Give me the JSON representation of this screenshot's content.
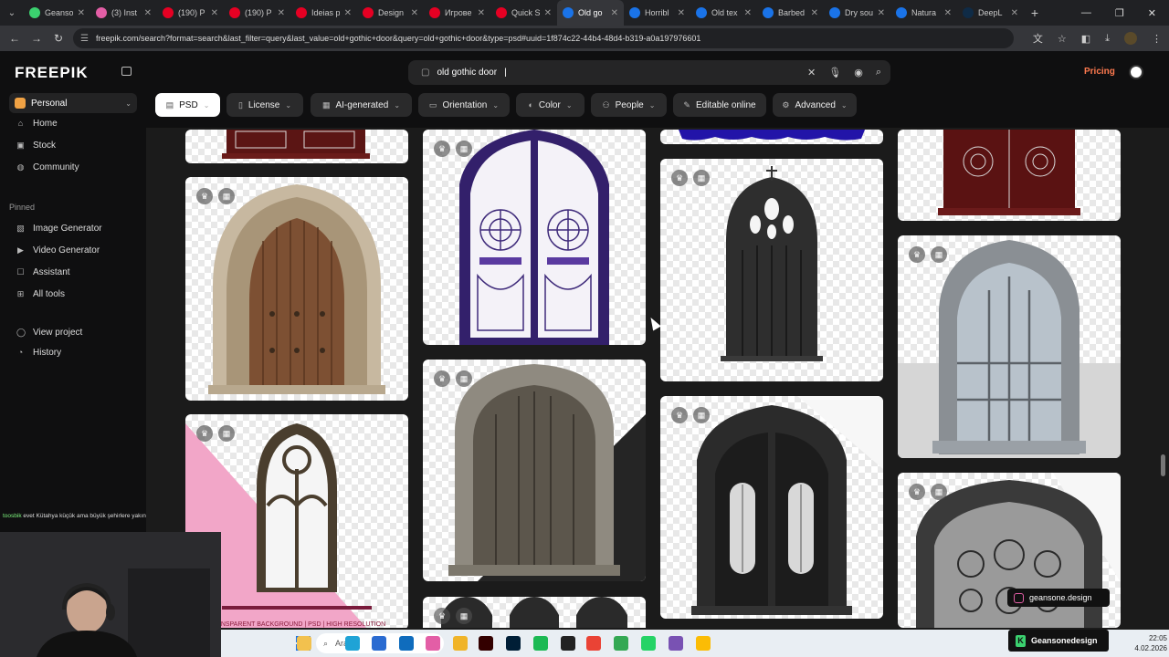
{
  "browser": {
    "tabs": [
      {
        "title": "Geanso",
        "color": "#3bd16f"
      },
      {
        "title": "(3) Inst",
        "color": "#e35ea6"
      },
      {
        "title": "(190) P",
        "color": "#e60023"
      },
      {
        "title": "(190) P",
        "color": "#e60023"
      },
      {
        "title": "Ideias p",
        "color": "#e60023"
      },
      {
        "title": "Design",
        "color": "#e60023"
      },
      {
        "title": "Игрове",
        "color": "#e60023"
      },
      {
        "title": "Quick S",
        "color": "#e60023"
      },
      {
        "title": "Old go",
        "color": "#1a73e8",
        "active": true
      },
      {
        "title": "Horribl",
        "color": "#1a73e8"
      },
      {
        "title": "Old tex",
        "color": "#1a73e8"
      },
      {
        "title": "Barbed",
        "color": "#1a73e8"
      },
      {
        "title": "Dry sou",
        "color": "#1a73e8"
      },
      {
        "title": "Natura",
        "color": "#1a73e8"
      },
      {
        "title": "DeepL",
        "color": "#0f2b46"
      }
    ],
    "url": "freepik.com/search?format=search&last_filter=query&last_value=old+gothic+door&query=old+gothic+door&type=psd#uuid=1f874c22-44b4-48d4-b319-a0a197976601"
  },
  "freepik": {
    "logo": "FREEPIK",
    "search_value": "old gothic door",
    "pricing": "Pricing",
    "workspace": "Personal",
    "nav_main": [
      {
        "label": "Home",
        "icon": "⌂"
      },
      {
        "label": "Stock",
        "icon": "▣"
      },
      {
        "label": "Community",
        "icon": "◍"
      }
    ],
    "pinned_label": "Pinned",
    "nav_pinned": [
      {
        "label": "Image Generator",
        "icon": "▧"
      },
      {
        "label": "Video Generator",
        "icon": "▶"
      },
      {
        "label": "Assistant",
        "icon": "☐"
      },
      {
        "label": "All tools",
        "icon": "⊞"
      }
    ],
    "nav_bottom": [
      {
        "label": "View project",
        "icon": "◯"
      },
      {
        "label": "History",
        "icon": "◔"
      }
    ],
    "filters": [
      {
        "label": "PSD",
        "icon": "▤"
      },
      {
        "label": "License",
        "icon": "▯"
      },
      {
        "label": "AI-generated",
        "icon": "▦"
      },
      {
        "label": "Orientation",
        "icon": "▭"
      },
      {
        "label": "Color",
        "icon": "◐"
      },
      {
        "label": "People",
        "icon": "⚇"
      },
      {
        "label": "Editable online",
        "icon": "✎"
      },
      {
        "label": "Advanced",
        "icon": "⚙"
      }
    ]
  },
  "overlay": {
    "chat_user": "toosbik",
    "chat_message": "evet Kütahya küçük ama büyük şehirlere yakın",
    "brand_instagram": "geansone.design",
    "brand_name": "Geansonedesign"
  },
  "taskbar": {
    "search_placeholder": "Ara",
    "time": "22:05",
    "date": "4.02.2026"
  },
  "colors": {
    "accent": "#ff7a4f",
    "background": "#0f0f10"
  }
}
